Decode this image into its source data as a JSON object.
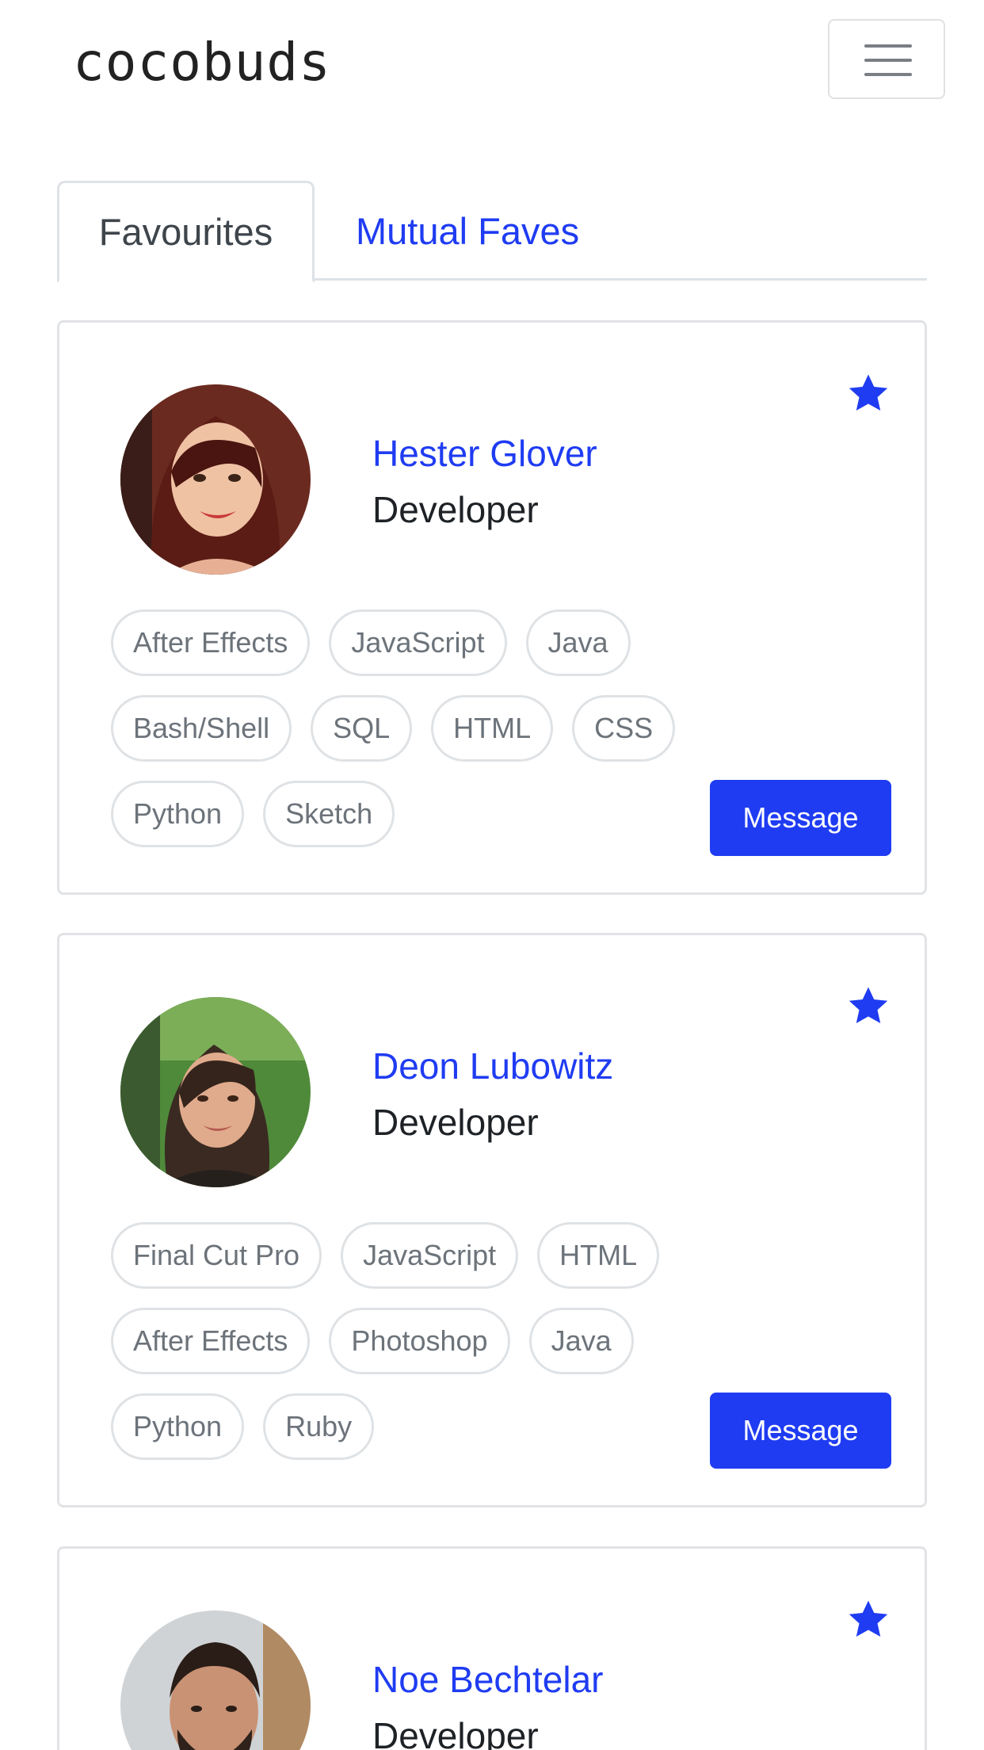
{
  "brand": "cocobuds",
  "tabs": [
    {
      "label": "Favourites",
      "active": true
    },
    {
      "label": "Mutual Faves",
      "active": false
    }
  ],
  "accent_color": "#1f3cf2",
  "cards": [
    {
      "name": "Hester Glover",
      "role": "Developer",
      "favourited": true,
      "tag_rows": [
        [
          "After Effects",
          "JavaScript",
          "Java"
        ],
        [
          "Bash/Shell",
          "SQL",
          "HTML",
          "CSS"
        ],
        [
          "Python",
          "Sketch"
        ]
      ],
      "message_label": "Message"
    },
    {
      "name": "Deon Lubowitz",
      "role": "Developer",
      "favourited": true,
      "tag_rows": [
        [
          "Final Cut Pro",
          "JavaScript",
          "HTML"
        ],
        [
          "After Effects",
          "Photoshop",
          "Java"
        ],
        [
          "Python",
          "Ruby"
        ]
      ],
      "message_label": "Message"
    },
    {
      "name": "Noe Bechtelar",
      "role": "Developer",
      "favourited": true
    }
  ]
}
